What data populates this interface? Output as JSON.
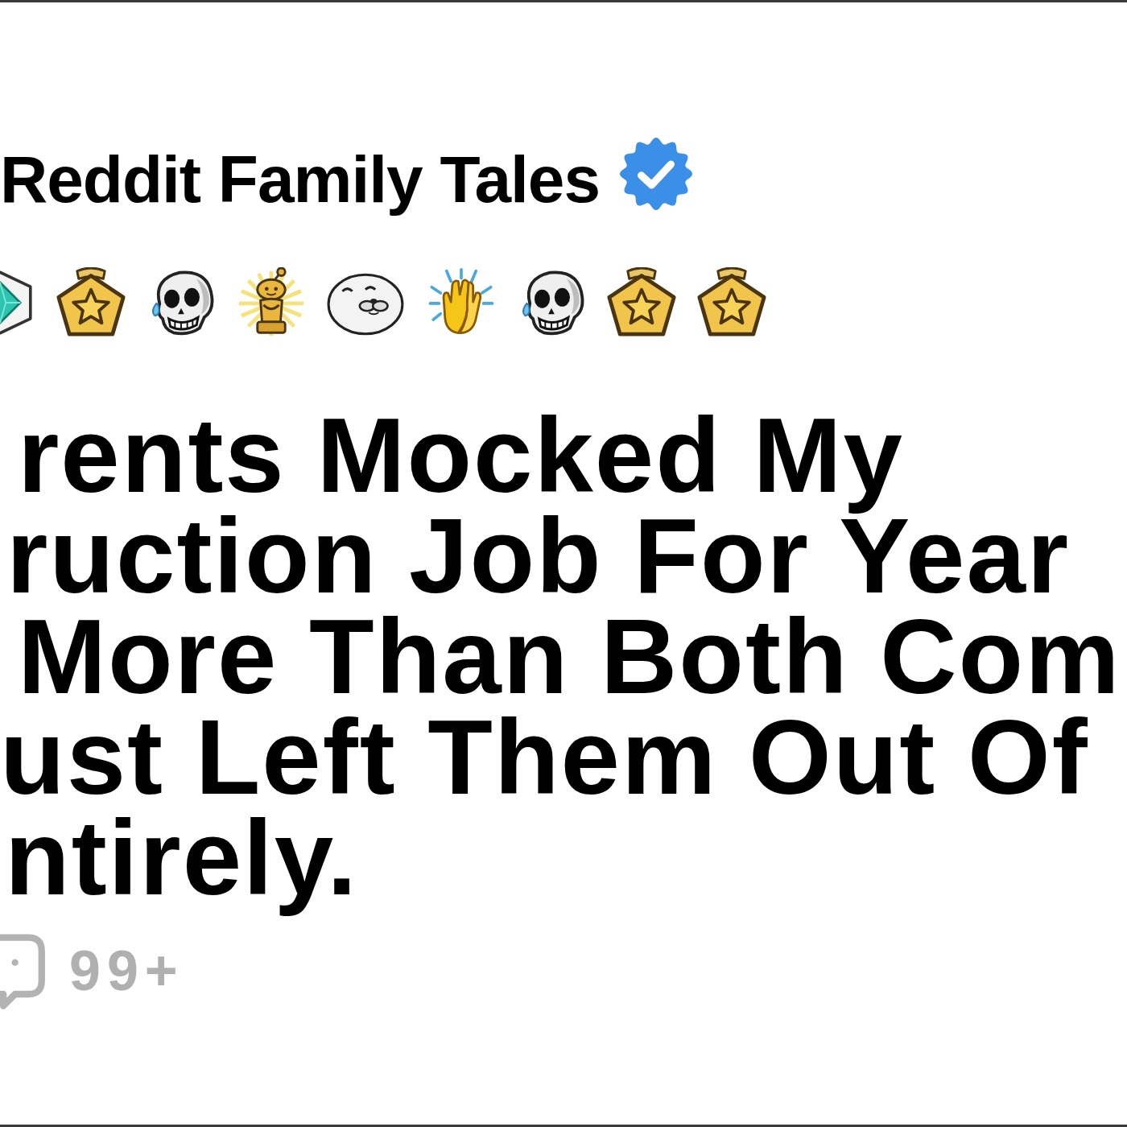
{
  "author": {
    "name": "Reddit Family Tales",
    "verified": true
  },
  "awards": [
    {
      "kind": "gem"
    },
    {
      "kind": "star"
    },
    {
      "kind": "skull"
    },
    {
      "kind": "trophy"
    },
    {
      "kind": "seal"
    },
    {
      "kind": "clap"
    },
    {
      "kind": "skull"
    },
    {
      "kind": "star"
    },
    {
      "kind": "star"
    }
  ],
  "title_lines": [
    "rents Mocked My",
    "ruction Job For Year",
    "More Than Both Com",
    "ust Left Them Out Of",
    "ntirely."
  ],
  "comments": {
    "count": "99+"
  }
}
